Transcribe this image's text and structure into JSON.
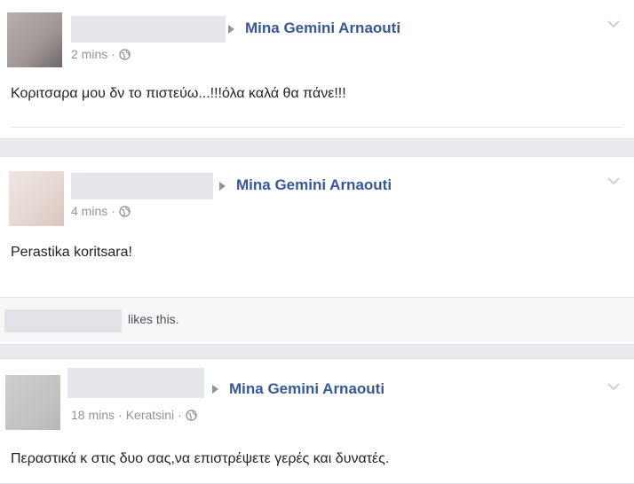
{
  "posts": [
    {
      "target": "Mina Gemini Arnaouti",
      "time": "2 mins",
      "separator": "·",
      "location": "",
      "text": "Κοριτσαρα μου δν το πιστεύω...!!!όλα καλά θα πάνε!!!"
    },
    {
      "target": "Mina Gemini Arnaouti",
      "time": "4 mins",
      "separator": "·",
      "location": "",
      "text": "Perastika koritsara!",
      "likes_text": "likes this."
    },
    {
      "target": "Mina Gemini Arnaouti",
      "time": "18 mins",
      "separator": "·",
      "location": "Keratsini",
      "text": "Περαστικά κ στις δυο σας,να επιστρέψετε γερές και δυνατές."
    }
  ],
  "icons": {
    "privacy": "globe-icon",
    "menu": "chevron-down-icon",
    "share_to": "triangle-arrow-icon"
  },
  "colors": {
    "link": "#365899",
    "meta": "#90949c",
    "background": "#e9ebee"
  }
}
